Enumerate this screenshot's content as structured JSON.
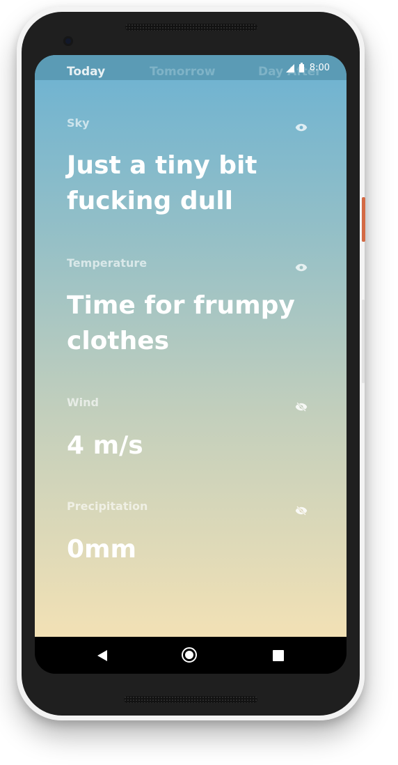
{
  "tabs": [
    {
      "label": "Today",
      "active": true
    },
    {
      "label": "Tomorrow",
      "active": false
    },
    {
      "label": "Day After",
      "active": false
    }
  ],
  "status_bar": {
    "time": "8:00",
    "icons": [
      "signal-icon",
      "battery-icon"
    ]
  },
  "sections": [
    {
      "label": "Sky",
      "value": "Just a tiny bit fucking dull",
      "visibility_icon": "eye-icon"
    },
    {
      "label": "Temperature",
      "value": "Time for frumpy clothes",
      "visibility_icon": "eye-icon"
    },
    {
      "label": "Wind",
      "value": "4 m/s",
      "visibility_icon": "eye-off-icon"
    },
    {
      "label": "Precipitation",
      "value": "0mm",
      "visibility_icon": "eye-off-icon"
    }
  ],
  "nav_bar": {
    "icons": [
      "back-icon",
      "home-icon",
      "recents-icon"
    ]
  },
  "colors": {
    "gradient_top": "#6cb2d2",
    "gradient_bottom": "#f2e1b5",
    "tab_bar": "#5b9bb5",
    "text": "#ffffff"
  }
}
